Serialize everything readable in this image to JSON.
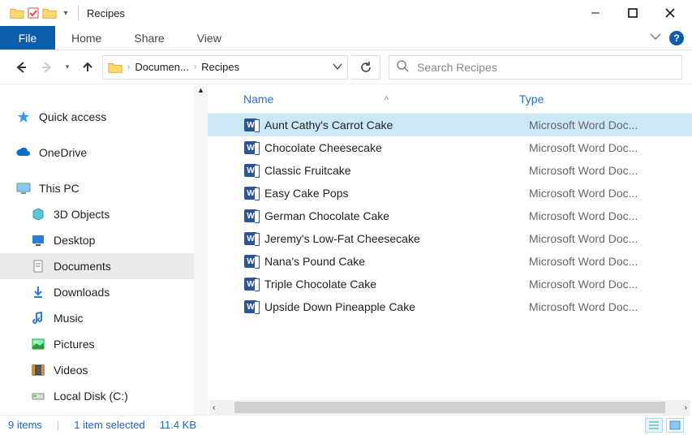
{
  "window": {
    "title": "Recipes"
  },
  "ribbon": {
    "file": "File",
    "tabs": [
      "Home",
      "Share",
      "View"
    ]
  },
  "breadcrumb": {
    "items": [
      "Documen...",
      "Recipes"
    ]
  },
  "search": {
    "placeholder": "Search Recipes"
  },
  "sidebar": {
    "quick_access": "Quick access",
    "onedrive": "OneDrive",
    "this_pc": "This PC",
    "items": [
      {
        "label": "3D Objects"
      },
      {
        "label": "Desktop"
      },
      {
        "label": "Documents",
        "selected": true
      },
      {
        "label": "Downloads"
      },
      {
        "label": "Music"
      },
      {
        "label": "Pictures"
      },
      {
        "label": "Videos"
      },
      {
        "label": "Local Disk (C:)"
      }
    ]
  },
  "columns": {
    "name": "Name",
    "type": "Type"
  },
  "files": [
    {
      "name": "Aunt Cathy's Carrot Cake",
      "type": "Microsoft Word Doc...",
      "selected": true
    },
    {
      "name": "Chocolate Cheesecake",
      "type": "Microsoft Word Doc..."
    },
    {
      "name": "Classic Fruitcake",
      "type": "Microsoft Word Doc..."
    },
    {
      "name": "Easy Cake Pops",
      "type": "Microsoft Word Doc..."
    },
    {
      "name": "German Chocolate Cake",
      "type": "Microsoft Word Doc..."
    },
    {
      "name": "Jeremy's Low-Fat Cheesecake",
      "type": "Microsoft Word Doc..."
    },
    {
      "name": "Nana's Pound Cake",
      "type": "Microsoft Word Doc..."
    },
    {
      "name": "Triple Chocolate Cake",
      "type": "Microsoft Word Doc..."
    },
    {
      "name": "Upside Down Pineapple Cake",
      "type": "Microsoft Word Doc..."
    }
  ],
  "status": {
    "count": "9 items",
    "selected": "1 item selected",
    "size": "11.4 KB"
  }
}
